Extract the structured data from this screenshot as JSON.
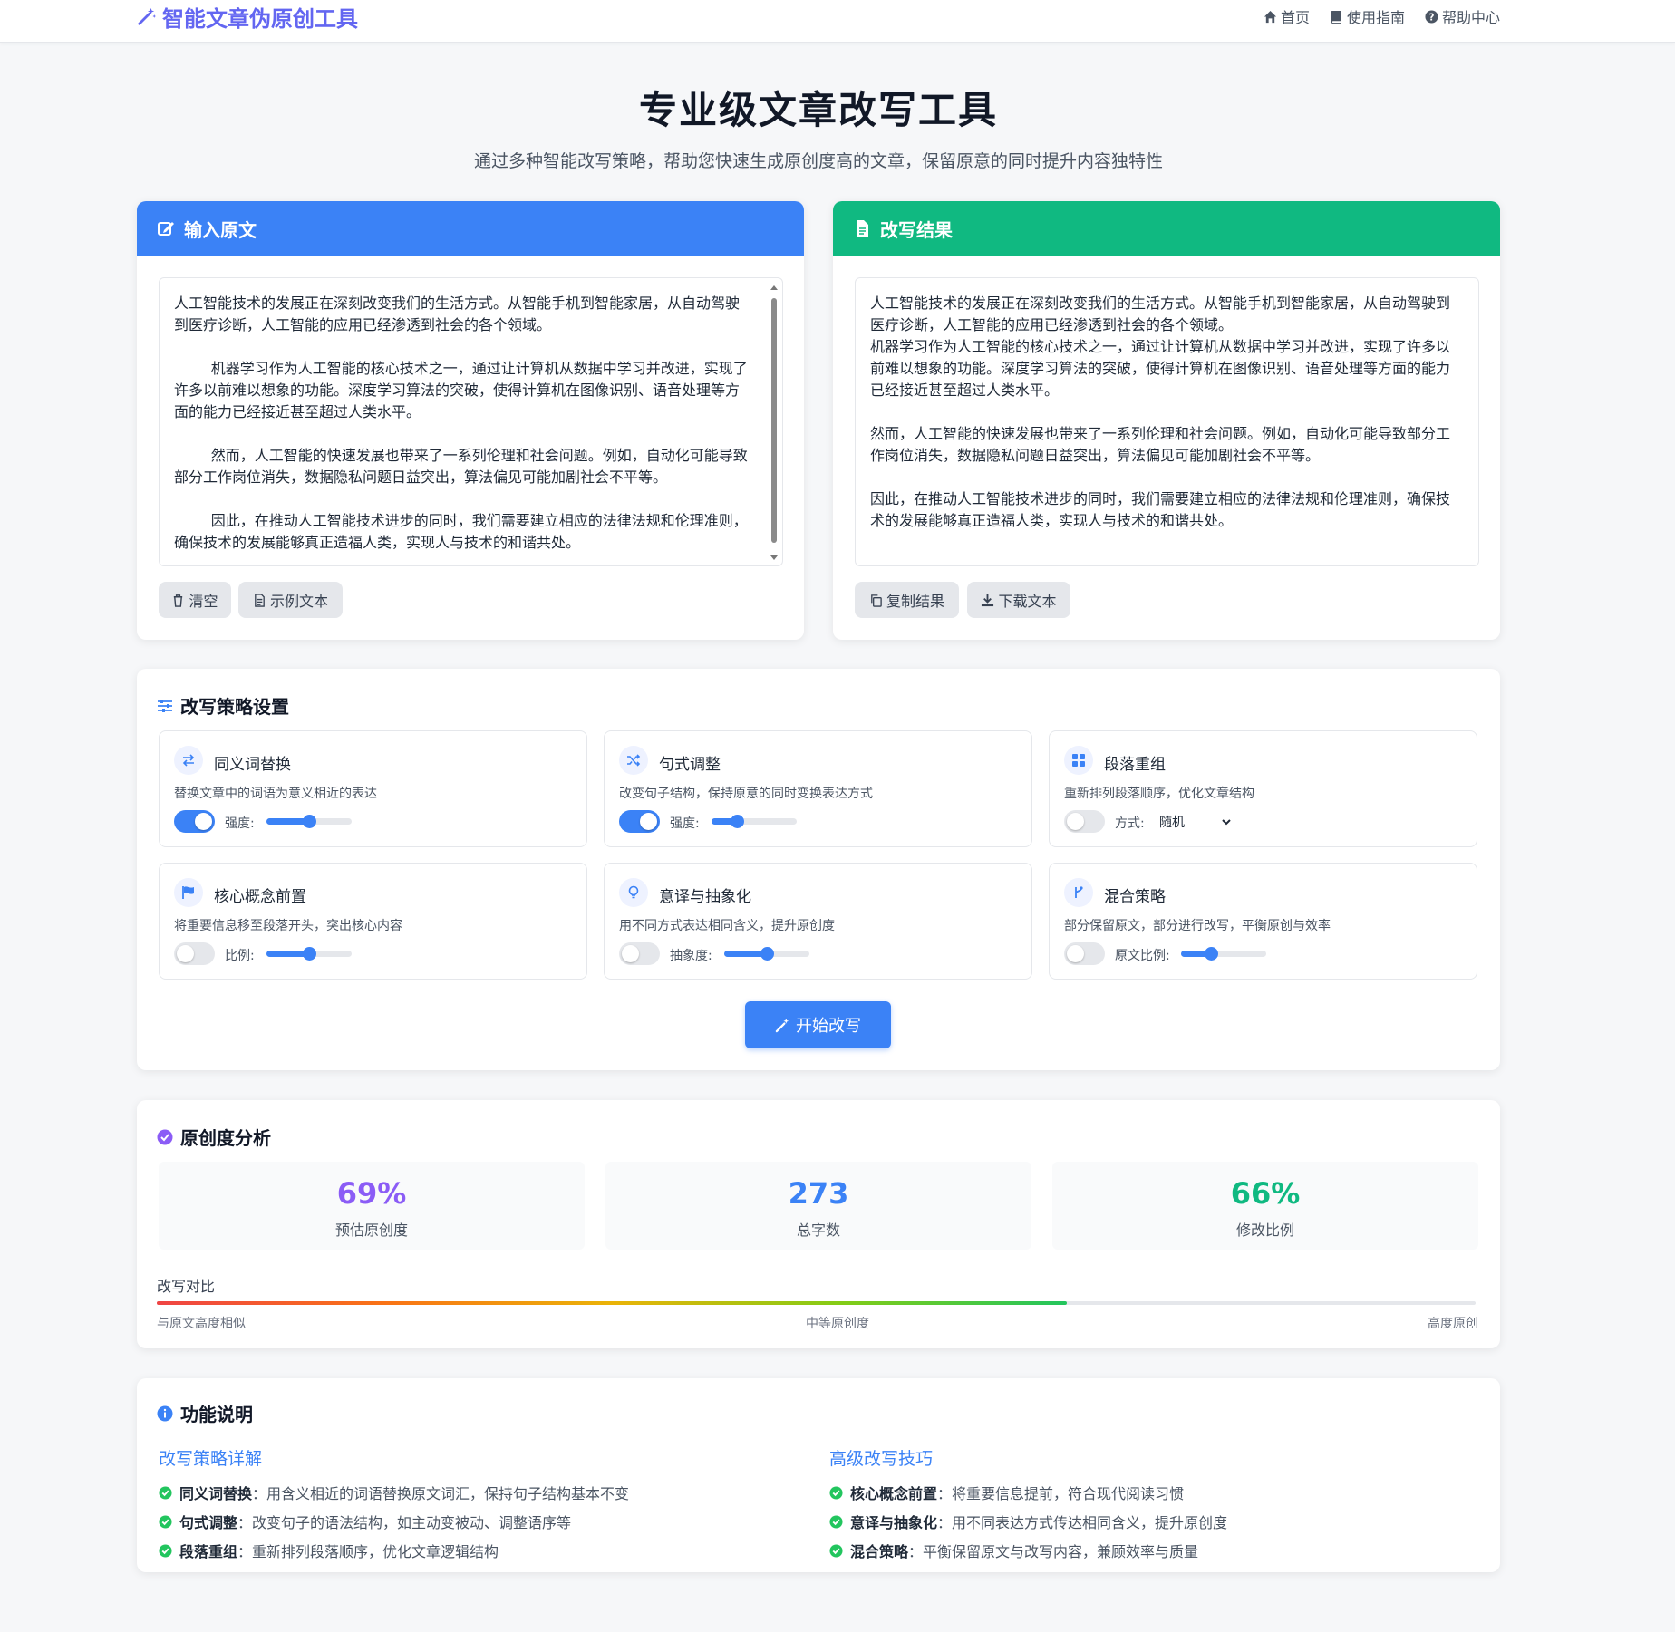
{
  "brand": {
    "title": "智能文章伪原创工具"
  },
  "nav": [
    {
      "label": "首页",
      "icon": "home-icon"
    },
    {
      "label": "使用指南",
      "icon": "book-icon"
    },
    {
      "label": "帮助中心",
      "icon": "question-icon"
    }
  ],
  "hero": {
    "title": "专业级文章改写工具",
    "subtitle": "通过多种智能改写策略，帮助您快速生成原创度高的文章，保留原意的同时提升内容独特性"
  },
  "input_panel": {
    "title": "输入原文",
    "icon": "edit-icon",
    "text": "人工智能技术的发展正在深刻改变我们的生活方式。从智能手机到智能家居，从自动驾驶到医疗诊断，人工智能的应用已经渗透到社会的各个领域。\n\n        机器学习作为人工智能的核心技术之一，通过让计算机从数据中学习并改进，实现了许多以前难以想象的功能。深度学习算法的突破，使得计算机在图像识别、语音处理等方面的能力已经接近甚至超过人类水平。\n\n        然而，人工智能的快速发展也带来了一系列伦理和社会问题。例如，自动化可能导致部分工作岗位消失，数据隐私问题日益突出，算法偏见可能加剧社会不平等。\n\n        因此，在推动人工智能技术进步的同时，我们需要建立相应的法律法规和伦理准则，确保技术的发展能够真正造福人类，实现人与技术的和谐共处。",
    "buttons": {
      "clear": "清空",
      "sample": "示例文本"
    },
    "colors": {
      "header": "#3b82f6"
    }
  },
  "result_panel": {
    "title": "改写结果",
    "icon": "file-icon",
    "text": "人工智能技术的发展正在深刻改变我们的生活方式。从智能手机到智能家居，从自动驾驶到医疗诊断，人工智能的应用已经渗透到社会的各个领域。\n机器学习作为人工智能的核心技术之一，通过让计算机从数据中学习并改进，实现了许多以前难以想象的功能。深度学习算法的突破，使得计算机在图像识别、语音处理等方面的能力已经接近甚至超过人类水平。\n\n然而，人工智能的快速发展也带来了一系列伦理和社会问题。例如，自动化可能导致部分工作岗位消失，数据隐私问题日益突出，算法偏见可能加剧社会不平等。\n\n因此，在推动人工智能技术进步的同时，我们需要建立相应的法律法规和伦理准则，确保技术的发展能够真正造福人类，实现人与技术的和谐共处。",
    "buttons": {
      "copy": "复制结果",
      "download": "下载文本"
    },
    "colors": {
      "header": "#10b981"
    }
  },
  "strategy": {
    "title": "改写策略设置",
    "cards": [
      {
        "title": "同义词替换",
        "desc": "替换文章中的词语为意义相近的表达",
        "icon": "swap-icon",
        "enabled": true,
        "control": "slider",
        "control_label": "强度:",
        "value": 0.5
      },
      {
        "title": "句式调整",
        "desc": "改变句子结构，保持原意的同时变换表达方式",
        "icon": "shuffle-icon",
        "enabled": true,
        "control": "slider",
        "control_label": "强度:",
        "value": 0.3
      },
      {
        "title": "段落重组",
        "desc": "重新排列段落顺序，优化文章结构",
        "icon": "grid-icon",
        "enabled": false,
        "control": "select",
        "control_label": "方式:",
        "selected": "随机"
      },
      {
        "title": "核心概念前置",
        "desc": "将重要信息移至段落开头，突出核心内容",
        "icon": "flag-icon",
        "enabled": false,
        "control": "slider",
        "control_label": "比例:",
        "value": 0.5
      },
      {
        "title": "意译与抽象化",
        "desc": "用不同方式表达相同含义，提升原创度",
        "icon": "lightbulb-icon",
        "enabled": false,
        "control": "slider",
        "control_label": "抽象度:",
        "value": 0.5
      },
      {
        "title": "混合策略",
        "desc": "部分保留原文，部分进行改写，平衡原创与效率",
        "icon": "branch-icon",
        "enabled": false,
        "control": "slider",
        "control_label": "原文比例:",
        "value": 0.35
      }
    ],
    "start_button": "开始改写"
  },
  "analysis": {
    "title": "原创度分析",
    "stats": [
      {
        "value": "69%",
        "label": "预估原创度",
        "color": "#8b5cf6"
      },
      {
        "value": "273",
        "label": "总字数",
        "color": "#3b82f6"
      },
      {
        "value": "66%",
        "label": "修改比例",
        "color": "#10b981"
      }
    ],
    "comparison": {
      "title": "改写对比",
      "progress": 0.69,
      "labels": {
        "left": "与原文高度相似",
        "middle": "中等原创度",
        "right": "高度原创"
      }
    }
  },
  "features": {
    "title": "功能说明",
    "columns": [
      {
        "title": "改写策略详解",
        "items": [
          {
            "term": "同义词替换",
            "desc": "：用含义相近的词语替换原文词汇，保持句子结构基本不变"
          },
          {
            "term": "句式调整",
            "desc": "：改变句子的语法结构，如主动变被动、调整语序等"
          },
          {
            "term": "段落重组",
            "desc": "：重新排列段落顺序，优化文章逻辑结构"
          }
        ]
      },
      {
        "title": "高级改写技巧",
        "items": [
          {
            "term": "核心概念前置",
            "desc": "：将重要信息提前，符合现代阅读习惯"
          },
          {
            "term": "意译与抽象化",
            "desc": "：用不同表达方式传达相同含义，提升原创度"
          },
          {
            "term": "混合策略",
            "desc": "：平衡保留原文与改写内容，兼顾效率与质量"
          }
        ]
      }
    ]
  }
}
